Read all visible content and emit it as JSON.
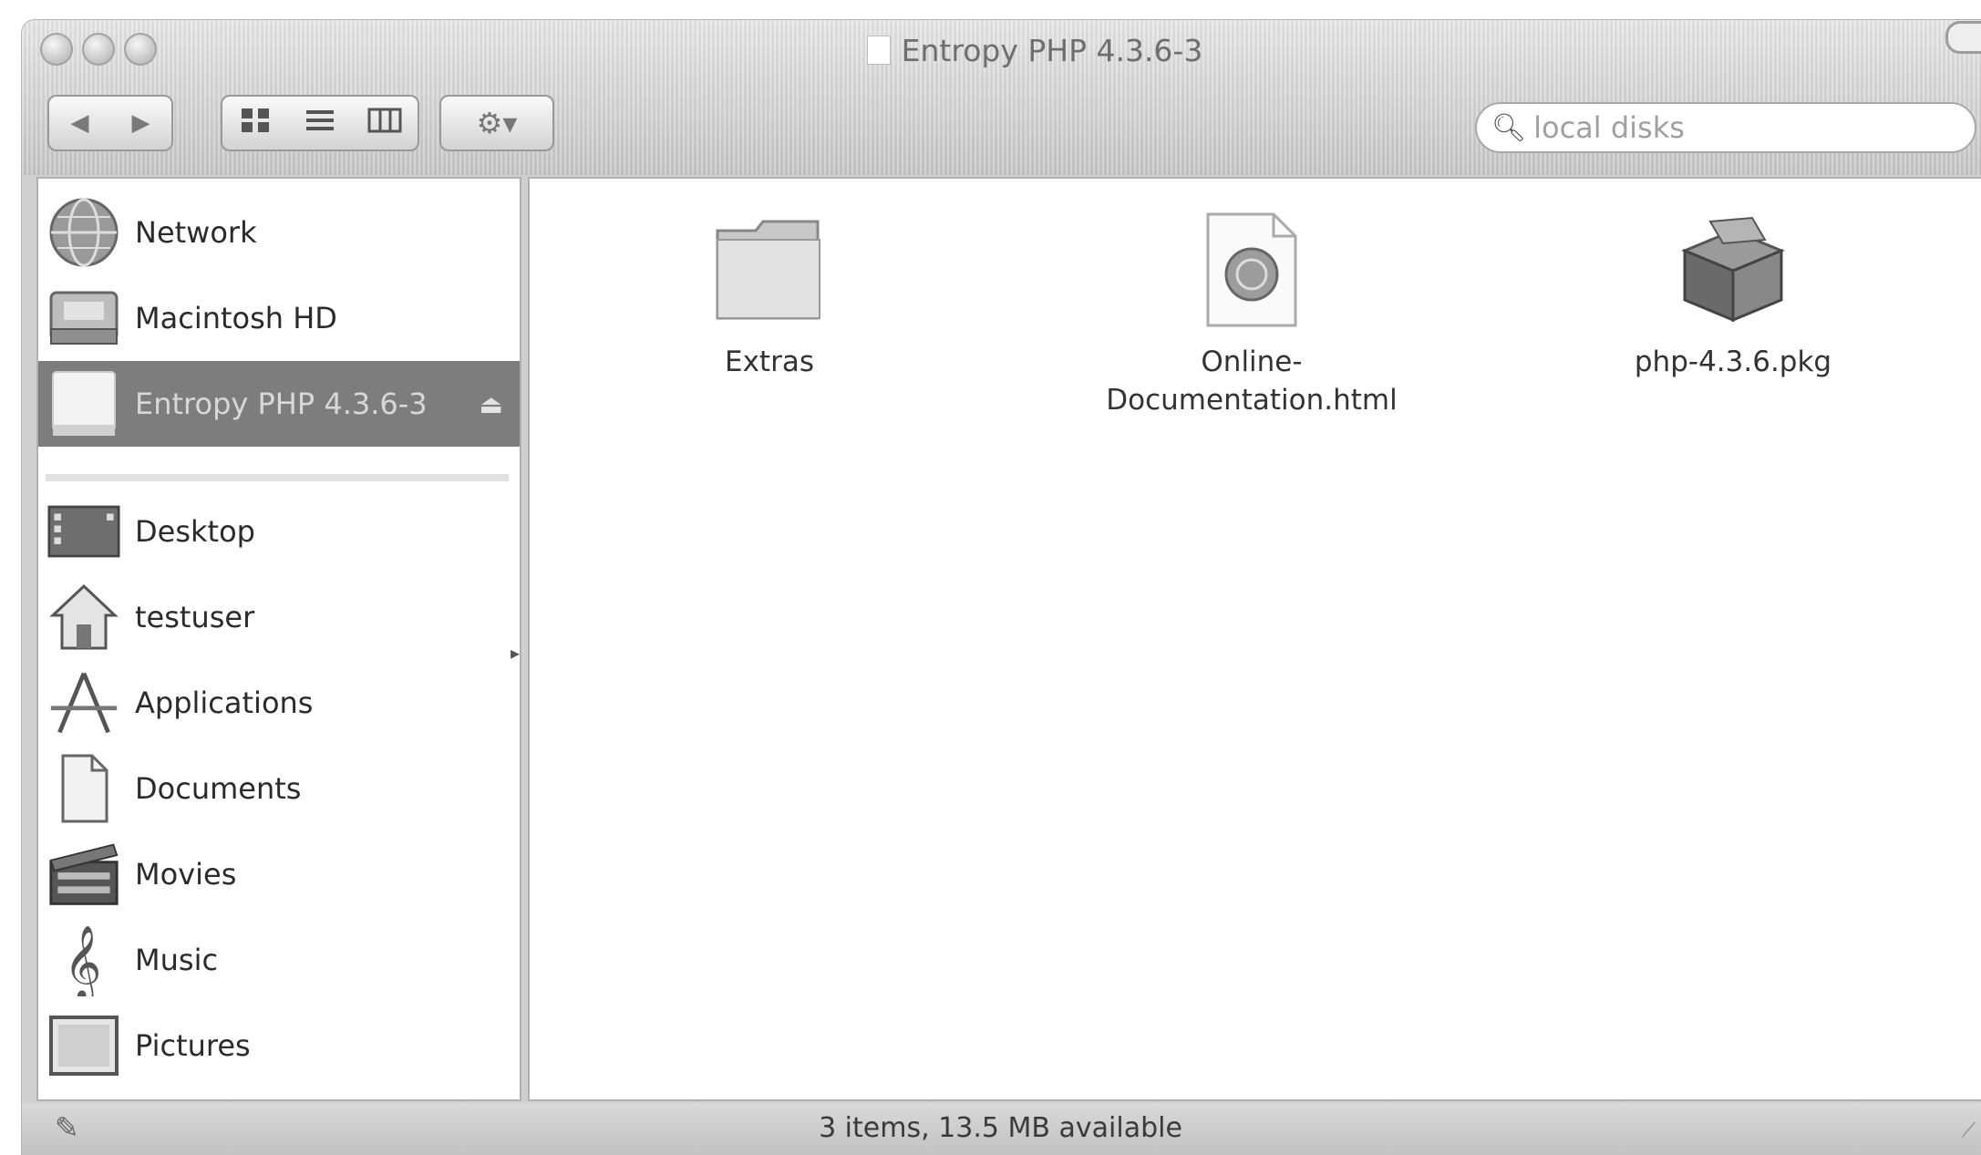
{
  "window": {
    "title": "Entropy PHP 4.3.6-3"
  },
  "toolbar": {
    "back_label": "◀",
    "forward_label": "▶",
    "views": [
      "icon-view",
      "list-view",
      "column-view"
    ],
    "action_label": "⚙▾",
    "search_placeholder": "local disks",
    "search_value": ""
  },
  "sidebar": {
    "devices": [
      {
        "label": "Network",
        "icon": "network-icon"
      },
      {
        "label": "Macintosh HD",
        "icon": "hard-disk-icon"
      },
      {
        "label": "Entropy PHP 4.3.6-3",
        "icon": "disk-image-icon",
        "selected": true,
        "eject": "⏏"
      }
    ],
    "places": [
      {
        "label": "Desktop",
        "icon": "desktop-icon"
      },
      {
        "label": "testuser",
        "icon": "home-icon"
      },
      {
        "label": "Applications",
        "icon": "applications-icon"
      },
      {
        "label": "Documents",
        "icon": "documents-icon"
      },
      {
        "label": "Movies",
        "icon": "movies-icon"
      },
      {
        "label": "Music",
        "icon": "music-icon"
      },
      {
        "label": "Pictures",
        "icon": "pictures-icon"
      }
    ]
  },
  "files": [
    {
      "name": "Extras",
      "icon": "folder-icon"
    },
    {
      "name": "Online-Documentation.html",
      "name_lines": [
        "Online-",
        "Documentation.html"
      ],
      "icon": "html-document-icon"
    },
    {
      "name": "php-4.3.6.pkg",
      "icon": "package-icon"
    }
  ],
  "status": {
    "text": "3 items, 13.5 MB available"
  }
}
